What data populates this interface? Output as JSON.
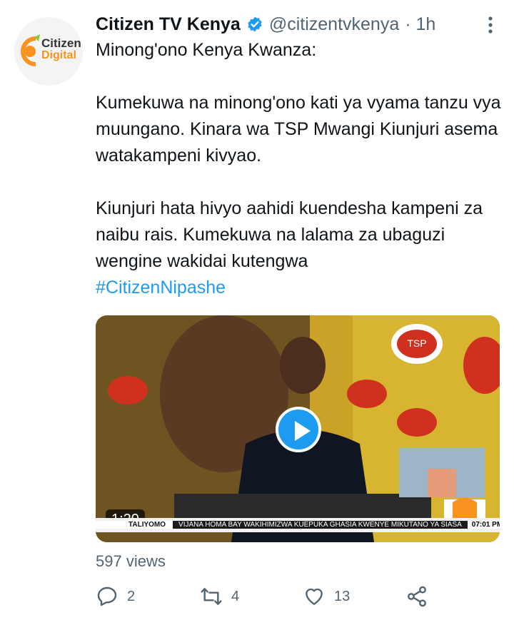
{
  "account": {
    "logo_text": "Citizen",
    "logo_subtext": "Digital",
    "name": "Citizen TV Kenya",
    "handle": "@citizentvkenya",
    "time": "· 1h"
  },
  "tweet": {
    "line1": "Minong'ono Kenya Kwanza:",
    "para1": "Kumekuwa na minong'ono kati ya vyama tanzu vya muungano. Kinara wa TSP Mwangi Kiunjuri asema watakampeni kivyao.",
    "para2": "Kiunjuri hata hivyo aahidi kuendesha kampeni za naibu rais. Kumekuwa na lalama za ubaguzi wengine wakidai kutengwa",
    "hashtag": "#CitizenNipashe"
  },
  "video": {
    "duration": "1:20",
    "ticker_tag": "TALIYOMO",
    "ticker_news": "VIJANA HOMA BAY WAKIHIMIZWA KUEPUKA GHASIA KWENYE MIKUTANO YA SIASA",
    "ticker_time": "07:01 PM",
    "watermark_text": "TSP"
  },
  "stats": {
    "views": "597 views",
    "replies": "2",
    "retweets": "4",
    "likes": "13"
  },
  "colors": {
    "accent": "#1d9bf0",
    "muted": "#536471",
    "logo_orange": "#f7931e",
    "logo_green": "#8dc63f"
  },
  "icons": [
    "citizen-digital-logo",
    "verified-badge-icon",
    "more-icon",
    "play-icon",
    "reply-icon",
    "retweet-icon",
    "like-icon",
    "share-icon"
  ]
}
